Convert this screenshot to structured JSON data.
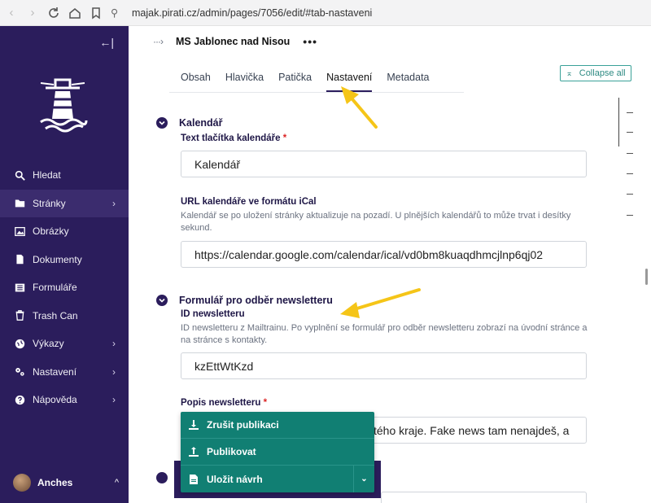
{
  "browser": {
    "url": "majak.pirati.cz/admin/pages/7056/edit/#tab-nastaveni"
  },
  "sidebar": {
    "items": [
      {
        "label": "Hledat",
        "icon": "search-icon"
      },
      {
        "label": "Stránky",
        "icon": "folder-icon",
        "active": true
      },
      {
        "label": "Obrázky",
        "icon": "image-icon"
      },
      {
        "label": "Dokumenty",
        "icon": "document-icon"
      },
      {
        "label": "Formuláře",
        "icon": "form-icon"
      },
      {
        "label": "Trash Can",
        "icon": "trash-icon"
      },
      {
        "label": "Výkazy",
        "icon": "globe-icon"
      },
      {
        "label": "Nastavení",
        "icon": "cogs-icon"
      },
      {
        "label": "Nápověda",
        "icon": "help-icon"
      }
    ],
    "user": {
      "name": "Anches"
    }
  },
  "header": {
    "title": "MS Jablonec nad Nisou",
    "more": "•••",
    "collapse_all": "Collapse all"
  },
  "tabs": [
    {
      "label": "Obsah"
    },
    {
      "label": "Hlavička"
    },
    {
      "label": "Patička"
    },
    {
      "label": "Nastavení",
      "active": true
    },
    {
      "label": "Metadata"
    }
  ],
  "sections": {
    "calendar": {
      "title": "Kalendář",
      "button_label": "Text tlačítka kalendáře",
      "button_value": "Kalendář",
      "url_label": "URL kalendáře ve formátu iCal",
      "url_help": "Kalendář se po uložení stránky aktualizuje na pozadí. U plnějších kalendářů to může trvat i desítky sekund.",
      "url_value": "https://calendar.google.com/calendar/ical/vd0bm8kuaqdhmcjlnp6qj02"
    },
    "newsletter": {
      "title": "Formulář pro odběr newsletteru",
      "id_label": "ID newsletteru",
      "id_help": "ID newsletteru z Mailtrainu. Po vyplnění se formulář pro odběr newsletteru zobrazí na úvodní stránce a na stránce s kontakty.",
      "id_value": "kzEttWtKzd",
      "desc_label": "Popis newsletteru",
      "desc_value": "tého kraje. Fake news tam nenajdeš, a"
    }
  },
  "publish_menu": {
    "items": [
      {
        "label": "Zrušit publikaci",
        "icon": "download-icon"
      },
      {
        "label": "Publikovat",
        "icon": "upload-icon"
      },
      {
        "label": "Uložit návrh",
        "icon": "save-draft-icon"
      }
    ]
  },
  "colors": {
    "sidebar": "#2b1d5c",
    "accent_teal": "#117f73",
    "annotation": "#f5c518"
  }
}
